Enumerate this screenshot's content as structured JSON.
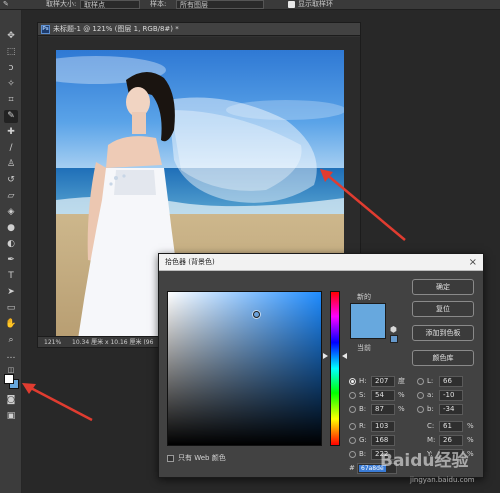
{
  "options_bar": {
    "sample_size_label": "取样大小:",
    "sample_size_value": "取样点",
    "sample_label": "样本:",
    "sample_value": "所有图层",
    "show_ring_label": "显示取样环"
  },
  "document": {
    "icon_text": "Ps",
    "tab_title": "未标题-1 @ 121% (图层 1, RGB/8#) *",
    "zoom": "121%",
    "info": "10.34 厘米 x 10.16 厘米 (96"
  },
  "colors": {
    "foreground": "#ffffff",
    "background": "#67a8de",
    "accent_arrow": "#e03c30"
  },
  "dialog": {
    "title": "拾色器 (背景色)",
    "close": "×",
    "new_label": "新的",
    "current_label": "当前",
    "buttons": {
      "ok": "确定",
      "reset": "复位",
      "add_swatch": "添加到色板",
      "library": "颜色库"
    },
    "fields": {
      "H": {
        "label": "H:",
        "value": "207",
        "unit": "度"
      },
      "S": {
        "label": "S:",
        "value": "54",
        "unit": "%"
      },
      "B": {
        "label": "B:",
        "value": "87",
        "unit": "%"
      },
      "R": {
        "label": "R:",
        "value": "103"
      },
      "G": {
        "label": "G:",
        "value": "168"
      },
      "Bl": {
        "label": "B:",
        "value": "222"
      },
      "L": {
        "label": "L:",
        "value": "66"
      },
      "a": {
        "label": "a:",
        "value": "-10"
      },
      "b": {
        "label": "b:",
        "value": "-34"
      },
      "C": {
        "label": "C:",
        "value": "61",
        "unit": "%"
      },
      "M": {
        "label": "M:",
        "value": "26",
        "unit": "%"
      },
      "Y": {
        "label": "Y:",
        "unit": "%"
      }
    },
    "hex_label": "#",
    "hex_value": "67a8de",
    "web_only": "只有 Web 颜色"
  },
  "watermark": {
    "brand": "Baidu经验",
    "url": "jingyan.baidu.com"
  }
}
